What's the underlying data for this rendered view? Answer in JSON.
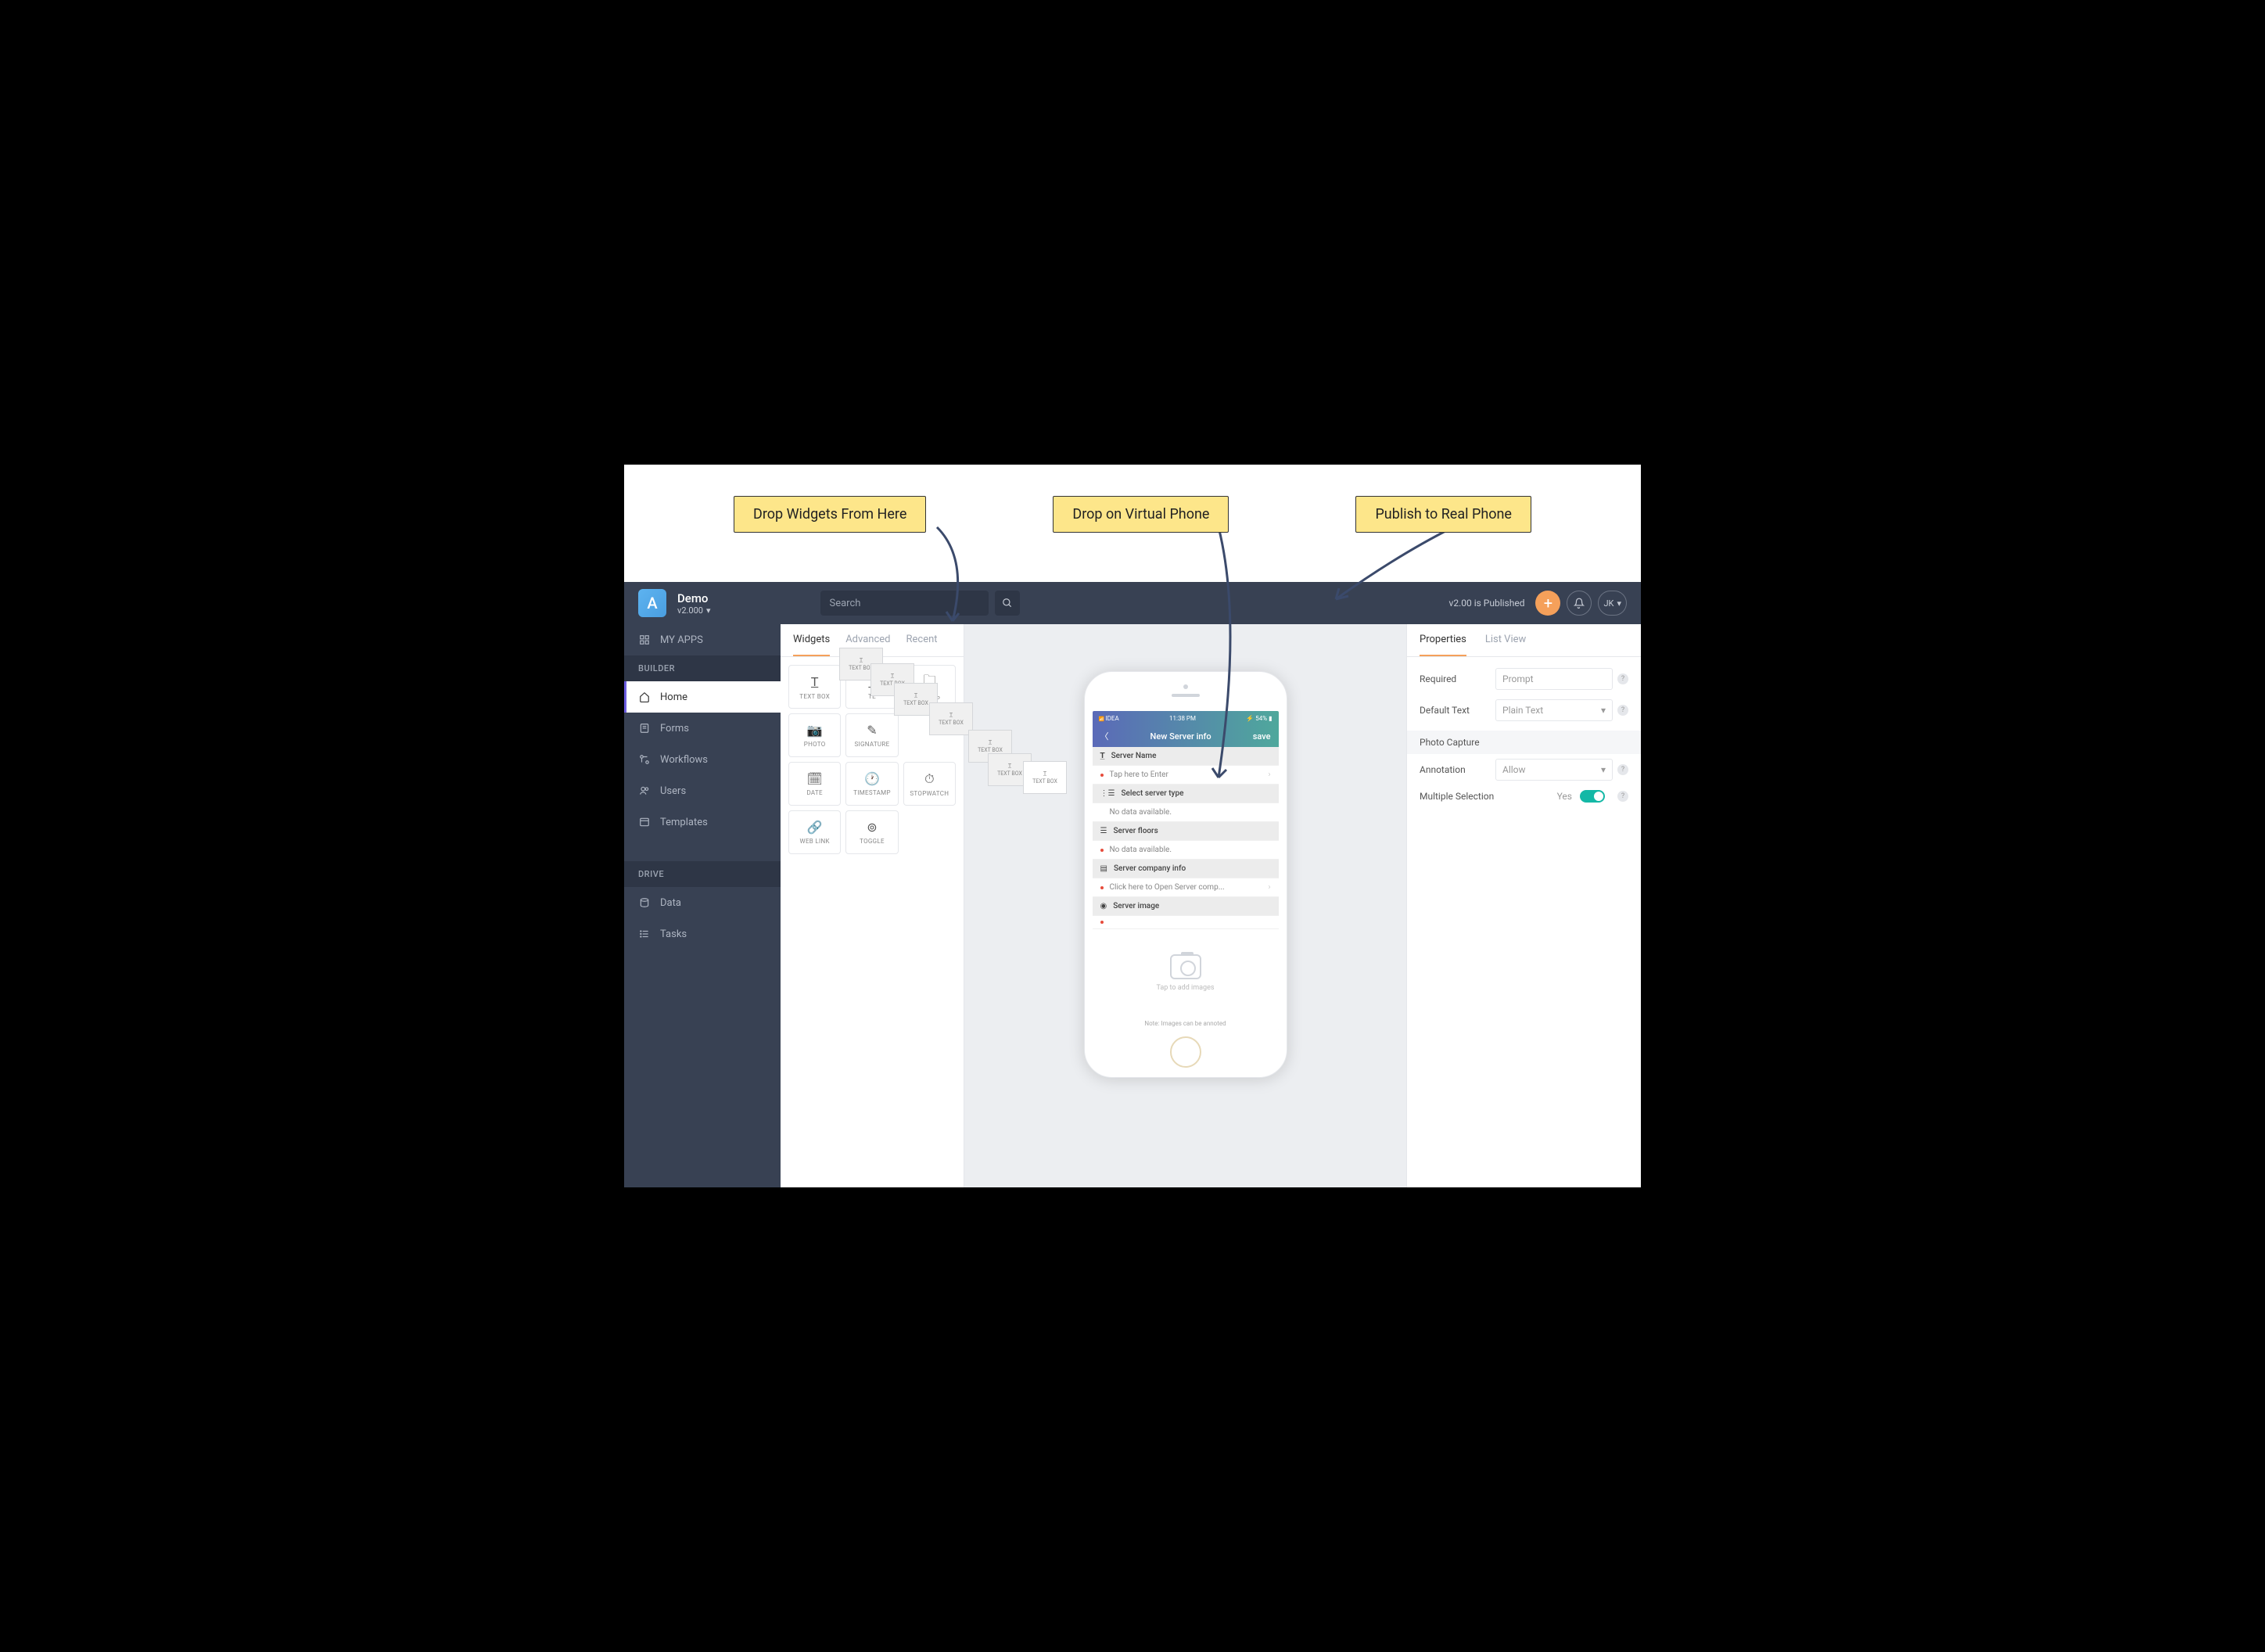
{
  "callouts": {
    "widgets": "Drop Widgets From Here",
    "phone": "Drop on Virtual Phone",
    "publish": "Publish to Real Phone"
  },
  "header": {
    "logo": "A",
    "title": "Demo",
    "version": "v2.000",
    "search_placeholder": "Search",
    "publish_status": "v2.00 is Published",
    "user_initials": "JK"
  },
  "sidebar": {
    "my_apps": "MY APPS",
    "sections": {
      "builder": "BUILDER",
      "drive": "DRIVE"
    },
    "items": {
      "home": "Home",
      "forms": "Forms",
      "workflows": "Workflows",
      "users": "Users",
      "templates": "Templates",
      "data": "Data",
      "tasks": "Tasks"
    }
  },
  "widget_tabs": {
    "widgets": "Widgets",
    "advanced": "Advanced",
    "recent": "Recent"
  },
  "widgets": {
    "text_box": "TEXT BOX",
    "text_box2": "TE",
    "group": "GROUP",
    "photo": "PHOTO",
    "signature": "SIGNATURE",
    "date": "DATE",
    "timestamp": "TIMESTAMP",
    "stopwatch": "STOPWATCH",
    "web_link": "WEB LINK",
    "toggle": "TOGGLE"
  },
  "ghost_label": "TEXT BOX",
  "phone": {
    "carrier": "IDEA",
    "time": "11:38 PM",
    "battery": "54%",
    "title": "New Server info",
    "save": "save",
    "fields": {
      "server_name": "Server Name",
      "tap_enter": "Tap here to Enter",
      "select_type": "Select server type",
      "no_data1": "No data available.",
      "floors": "Server floors",
      "no_data2": "No data available.",
      "company": "Server company info",
      "click_open": "Click here to Open Server comp...",
      "image": "Server image",
      "tap_images": "Tap to add images",
      "note": "Note: Images can be annoted"
    }
  },
  "props_tabs": {
    "properties": "Properties",
    "list_view": "List View"
  },
  "props": {
    "required": "Required",
    "required_value": "Prompt",
    "default_text": "Default Text",
    "default_value": "Plain Text",
    "photo_capture": "Photo Capture",
    "annotation": "Annotation",
    "annotation_value": "Allow",
    "multi_select": "Multiple Selection",
    "multi_value": "Yes"
  }
}
